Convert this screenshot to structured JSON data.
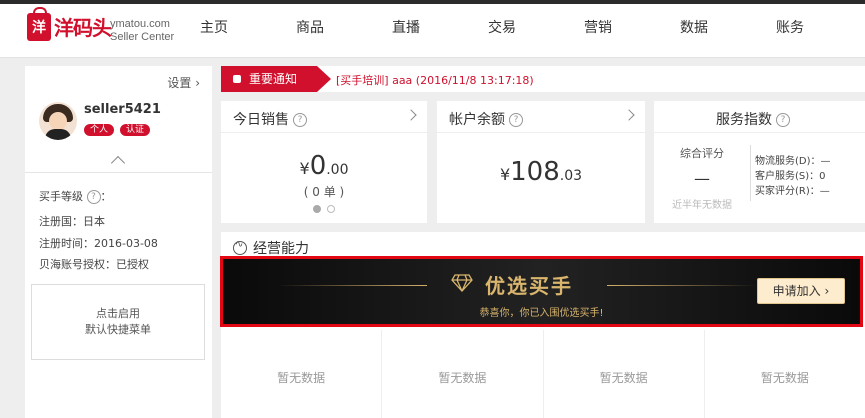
{
  "brand": {
    "logo_char": "洋",
    "name": "洋码头",
    "site": "ymatou.com",
    "site_sub": "Seller Center",
    "color": "#d0102c"
  },
  "nav": [
    "主页",
    "商品",
    "直播",
    "交易",
    "营销",
    "数据",
    "账务"
  ],
  "sidebar": {
    "settings": "设置",
    "username": "seller5421",
    "badges": [
      "个人",
      "认证"
    ],
    "buyer_level_label": "买手等级",
    "buyer_level_suffix": "：",
    "country": "注册国：日本",
    "reg_time": "注册时间：2016-03-08",
    "auth": "贝海账号授权：已授权",
    "shortcut_line1": "点击启用",
    "shortcut_line2": "默认快捷菜单"
  },
  "notice": {
    "label": "重要通知",
    "text": "[买手培训] aaa (2016/11/8 13:17:18)"
  },
  "sales": {
    "title": "今日销售",
    "currency": "¥",
    "integer": "0",
    "decimal": ".00",
    "count": "( 0 单 )"
  },
  "balance": {
    "title": "帐户余额",
    "currency": "¥",
    "integer": "108",
    "decimal": ".03"
  },
  "service": {
    "title": "服务指数",
    "overall_label": "综合评分",
    "overall_value": "—",
    "overall_note": "近半年无数据",
    "logistics": "物流服务(D)：—",
    "customer": "客户服务(S)：0",
    "buyer_rating": "买家评分(R)：—"
  },
  "operations": {
    "title": "经营能力",
    "banner_title": "优选买手",
    "banner_sub": "恭喜你，你已入围优选买手!",
    "apply_label": "申请加入",
    "nodata": [
      "暂无数据",
      "暂无数据",
      "暂无数据",
      "暂无数据"
    ]
  }
}
